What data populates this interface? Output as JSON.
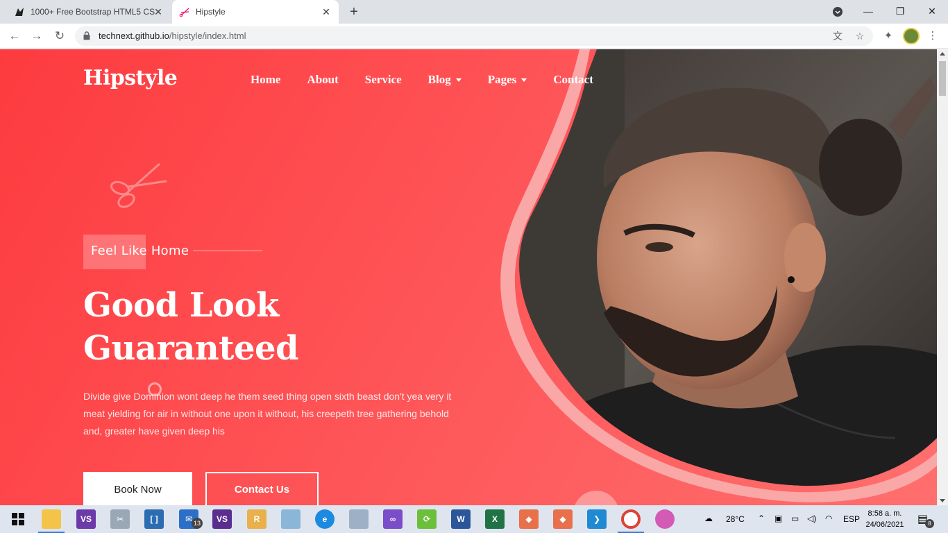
{
  "browser": {
    "tabs": [
      {
        "title": "1000+ Free Bootstrap HTML5 CS",
        "icon": "colorlib-icon",
        "active": false
      },
      {
        "title": "Hipstyle",
        "icon": "scissors-favicon-icon",
        "active": true
      }
    ],
    "new_tab_label": "+",
    "url_host": "technext.github.io",
    "url_path": "/hipstyle/index.html",
    "window_controls": {
      "minimize": "—",
      "maximize": "❐",
      "close": "✕"
    }
  },
  "page": {
    "brand": "Hipstyle",
    "nav": [
      {
        "label": "Home",
        "dropdown": false
      },
      {
        "label": "About",
        "dropdown": false
      },
      {
        "label": "Service",
        "dropdown": false
      },
      {
        "label": "Blog",
        "dropdown": true
      },
      {
        "label": "Pages",
        "dropdown": true
      },
      {
        "label": "Contact",
        "dropdown": false
      }
    ],
    "tagline": "Feel Like Home",
    "headline_line1": "Good Look",
    "headline_line2": "Guaranteed",
    "description": "Divide give Dominion wont deep he them seed thing open sixth beast don't yea very it meat yielding for air in without one upon it without, his creepeth tree gathering behold and, greater have given deep his",
    "buttons": {
      "book": "Book Now",
      "contact": "Contact Us"
    },
    "colors": {
      "accent": "#fe4a4d",
      "accent_light": "#ff7272",
      "blob": "#f9a7a7"
    }
  },
  "taskbar": {
    "apps": [
      "start-icon",
      "file-explorer-icon",
      "visual-studio-icon",
      "snipping-tool-icon",
      "brackets-icon",
      "mail-icon",
      "visual-studio-preview-icon",
      "notepad-icon",
      "file-manager-icon",
      "edge-icon",
      "sql-server-icon",
      "vs-purple-icon",
      "sync-icon",
      "word-icon",
      "excel-icon",
      "git-icon",
      "git-icon-2",
      "vscode-icon",
      "chrome-icon",
      "paint-icon"
    ],
    "mail_badge": "13",
    "temperature": "28°C",
    "language": "ESP",
    "time": "8:58 a. m.",
    "date": "24/06/2021",
    "notification_count": "8"
  }
}
